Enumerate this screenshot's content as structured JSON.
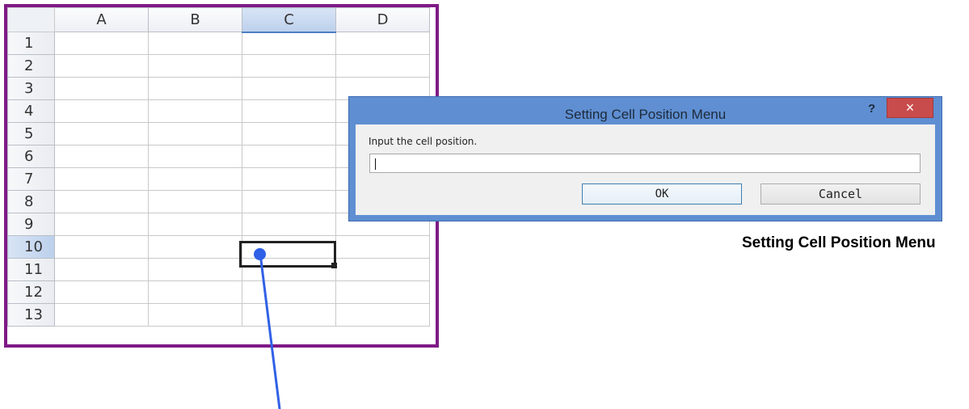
{
  "spreadsheet": {
    "columns": [
      "A",
      "B",
      "C",
      "D"
    ],
    "rows": [
      "1",
      "2",
      "3",
      "4",
      "5",
      "6",
      "7",
      "8",
      "9",
      "10",
      "11",
      "12",
      "13"
    ],
    "selected_column": "C",
    "selected_row": "10",
    "frame_color": "#7f1a86"
  },
  "dialog": {
    "title": "Setting Cell Position Menu",
    "help_label": "?",
    "close_label": "×",
    "prompt": "Input the cell position.",
    "input_value": "",
    "ok_label": "OK",
    "cancel_label": "Cancel",
    "titlebar_color": "#5f8fd2",
    "close_color": "#c94c4c"
  },
  "caption": "Setting Cell Position Menu",
  "pointer_color": "#2f60e6"
}
